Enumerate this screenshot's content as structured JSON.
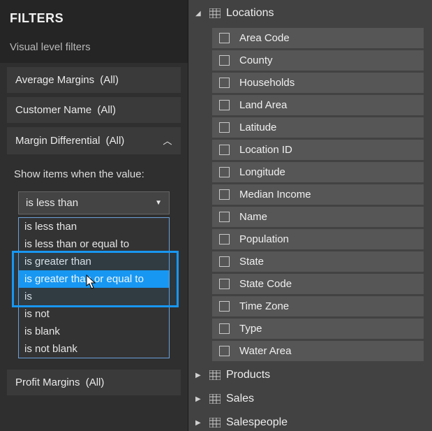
{
  "filters": {
    "header": "FILTERS",
    "subheader": "Visual level filters",
    "items": [
      {
        "name": "Average Margins",
        "scope": "(All)",
        "expanded": false
      },
      {
        "name": "Customer Name",
        "scope": "(All)",
        "expanded": false
      },
      {
        "name": "Margin Differential",
        "scope": "(All)",
        "expanded": true
      },
      {
        "name": "Profit Margins",
        "scope": "(All)",
        "expanded": false
      }
    ],
    "show_label": "Show items when the value:",
    "selected_condition": "is less than",
    "condition_options": [
      "is less than",
      "is less than or equal to",
      "is greater than",
      "is greater than or equal to",
      "is",
      "is not",
      "is blank",
      "is not blank"
    ],
    "highlighted_option_index": 3
  },
  "fields": {
    "groups": [
      {
        "name": "Locations",
        "expanded": true,
        "fields": [
          "Area Code",
          "County",
          "Households",
          "Land Area",
          "Latitude",
          "Location ID",
          "Longitude",
          "Median Income",
          "Name",
          "Population",
          "State",
          "State Code",
          "Time Zone",
          "Type",
          "Water Area"
        ]
      },
      {
        "name": "Products",
        "expanded": false
      },
      {
        "name": "Sales",
        "expanded": false
      },
      {
        "name": "Salespeople",
        "expanded": false
      }
    ]
  }
}
